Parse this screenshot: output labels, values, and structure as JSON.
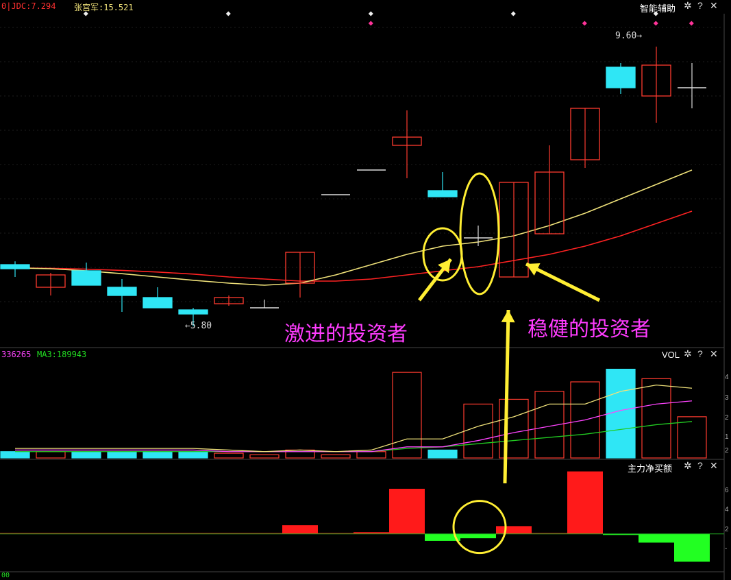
{
  "colors": {
    "up": "#ff3b2f",
    "down": "#2fe6f5",
    "ma_short": "#f0e27a",
    "ma_long": "#ff2222",
    "vol_ma1": "#f0e27a",
    "vol_ma2": "#ff44ff",
    "vol_ma3": "#22cc22",
    "annotation_text": "#ff3cff",
    "annotation_mark": "#ffee33",
    "flow_pos": "#ff1a1a",
    "flow_neg": "#22ff22"
  },
  "top_bar": {
    "indicator_1": "0|JDC:7.294",
    "indicator_2": "张宫军:15.521",
    "tool_name": "智能辅助"
  },
  "price_panel": {
    "low_label": "←5.80",
    "high_label": "9.60→",
    "annotation_aggressive": "激进的投资者",
    "annotation_steady": "稳健的投资者"
  },
  "volume_panel": {
    "label_left": "336265",
    "label_ma3": "MA3:189943",
    "name": "VOL",
    "ticks": [
      "4",
      "3",
      "2",
      "1",
      "2"
    ]
  },
  "flow_panel": {
    "name": "主力净买额",
    "ticks": [
      "6",
      "4",
      "2",
      "-"
    ],
    "bottom_label": "00"
  },
  "controls": {
    "settings_icon": "✲",
    "help_icon": "?",
    "close_icon": "✕"
  },
  "chart_data": {
    "type": "candlestick",
    "candles": [
      {
        "open": 7.3,
        "close": 7.2,
        "high": 7.38,
        "low": 7.0
      },
      {
        "open": 6.75,
        "close": 7.05,
        "high": 7.1,
        "low": 6.55
      },
      {
        "open": 7.15,
        "close": 6.8,
        "high": 7.35,
        "low": 6.8
      },
      {
        "open": 6.75,
        "close": 6.55,
        "high": 6.95,
        "low": 6.15
      },
      {
        "open": 6.5,
        "close": 6.25,
        "high": 6.75,
        "low": 6.25
      },
      {
        "open": 6.2,
        "close": 6.1,
        "high": 6.25,
        "low": 5.8
      },
      {
        "open": 6.35,
        "close": 6.5,
        "high": 6.55,
        "low": 6.3
      },
      {
        "open": 6.25,
        "close": 6.25,
        "high": 6.45,
        "low": 6.25
      },
      {
        "open": 6.85,
        "close": 7.6,
        "high": 7.6,
        "low": 6.5
      },
      {
        "open": 9.0,
        "close": 9.0,
        "high": 9.0,
        "low": 9.0
      },
      {
        "open": 9.6,
        "close": 9.6,
        "high": 9.6,
        "low": 9.6
      },
      {
        "open": 10.2,
        "close": 10.4,
        "high": 11.05,
        "low": 9.4
      },
      {
        "open": 9.1,
        "close": 8.95,
        "high": 9.55,
        "low": 8.95
      },
      {
        "open": 7.95,
        "close": 7.95,
        "high": 8.25,
        "low": 7.75
      },
      {
        "open": 7.0,
        "close": 9.3,
        "high": 9.3,
        "low": 7.0
      },
      {
        "open": 8.05,
        "close": 9.55,
        "high": 10.2,
        "low": 8.05
      },
      {
        "open": 9.85,
        "close": 11.1,
        "high": 11.1,
        "low": 9.65
      },
      {
        "open": 12.1,
        "close": 11.6,
        "high": 12.2,
        "low": 11.45
      },
      {
        "open": 11.4,
        "close": 12.15,
        "high": 12.6,
        "low": 10.75
      },
      {
        "open": 11.6,
        "close": 11.6,
        "high": 12.2,
        "low": 11.1
      }
    ],
    "ma_short": [
      7.22,
      7.2,
      7.15,
      7.08,
      7.0,
      6.92,
      6.85,
      6.8,
      6.85,
      7.05,
      7.3,
      7.55,
      7.75,
      7.85,
      8.0,
      8.25,
      8.55,
      8.9,
      9.25,
      9.6
    ],
    "ma_long": [
      7.22,
      7.21,
      7.19,
      7.16,
      7.12,
      7.07,
      7.0,
      6.95,
      6.9,
      6.9,
      6.95,
      7.05,
      7.15,
      7.25,
      7.4,
      7.55,
      7.75,
      8.0,
      8.3,
      8.6
    ],
    "volume": {
      "values": [
        0.2,
        0.2,
        0.2,
        0.2,
        0.2,
        0.2,
        0.15,
        0.1,
        0.25,
        0.1,
        0.2,
        2.7,
        0.25,
        1.7,
        1.85,
        2.1,
        2.4,
        2.8,
        2.5,
        1.3
      ],
      "ma1": [
        0.3,
        0.3,
        0.3,
        0.3,
        0.3,
        0.3,
        0.25,
        0.2,
        0.25,
        0.2,
        0.25,
        0.6,
        0.6,
        1.0,
        1.3,
        1.7,
        1.7,
        2.1,
        2.3,
        2.2
      ],
      "ma2": [
        0.25,
        0.25,
        0.25,
        0.25,
        0.25,
        0.25,
        0.2,
        0.2,
        0.2,
        0.2,
        0.2,
        0.35,
        0.35,
        0.55,
        0.8,
        1.0,
        1.2,
        1.5,
        1.7,
        1.8
      ],
      "ma3": [
        0.2,
        0.2,
        0.2,
        0.2,
        0.2,
        0.2,
        0.2,
        0.2,
        0.2,
        0.2,
        0.2,
        0.3,
        0.35,
        0.45,
        0.55,
        0.65,
        0.75,
        0.9,
        1.05,
        1.15
      ]
    },
    "net_buy": [
      0.1,
      0.1,
      0.1,
      0.1,
      0.1,
      0.1,
      0.1,
      0.1,
      1.0,
      0.1,
      0.2,
      5.2,
      -0.8,
      -0.5,
      0.9,
      0.1,
      7.2,
      -0.1,
      -1.0,
      -3.2
    ],
    "price_ylim": [
      5.4,
      13.4
    ],
    "volume_ylim": [
      0,
      3.2
    ],
    "net_buy_ylim": [
      -4.2,
      7.8
    ]
  }
}
